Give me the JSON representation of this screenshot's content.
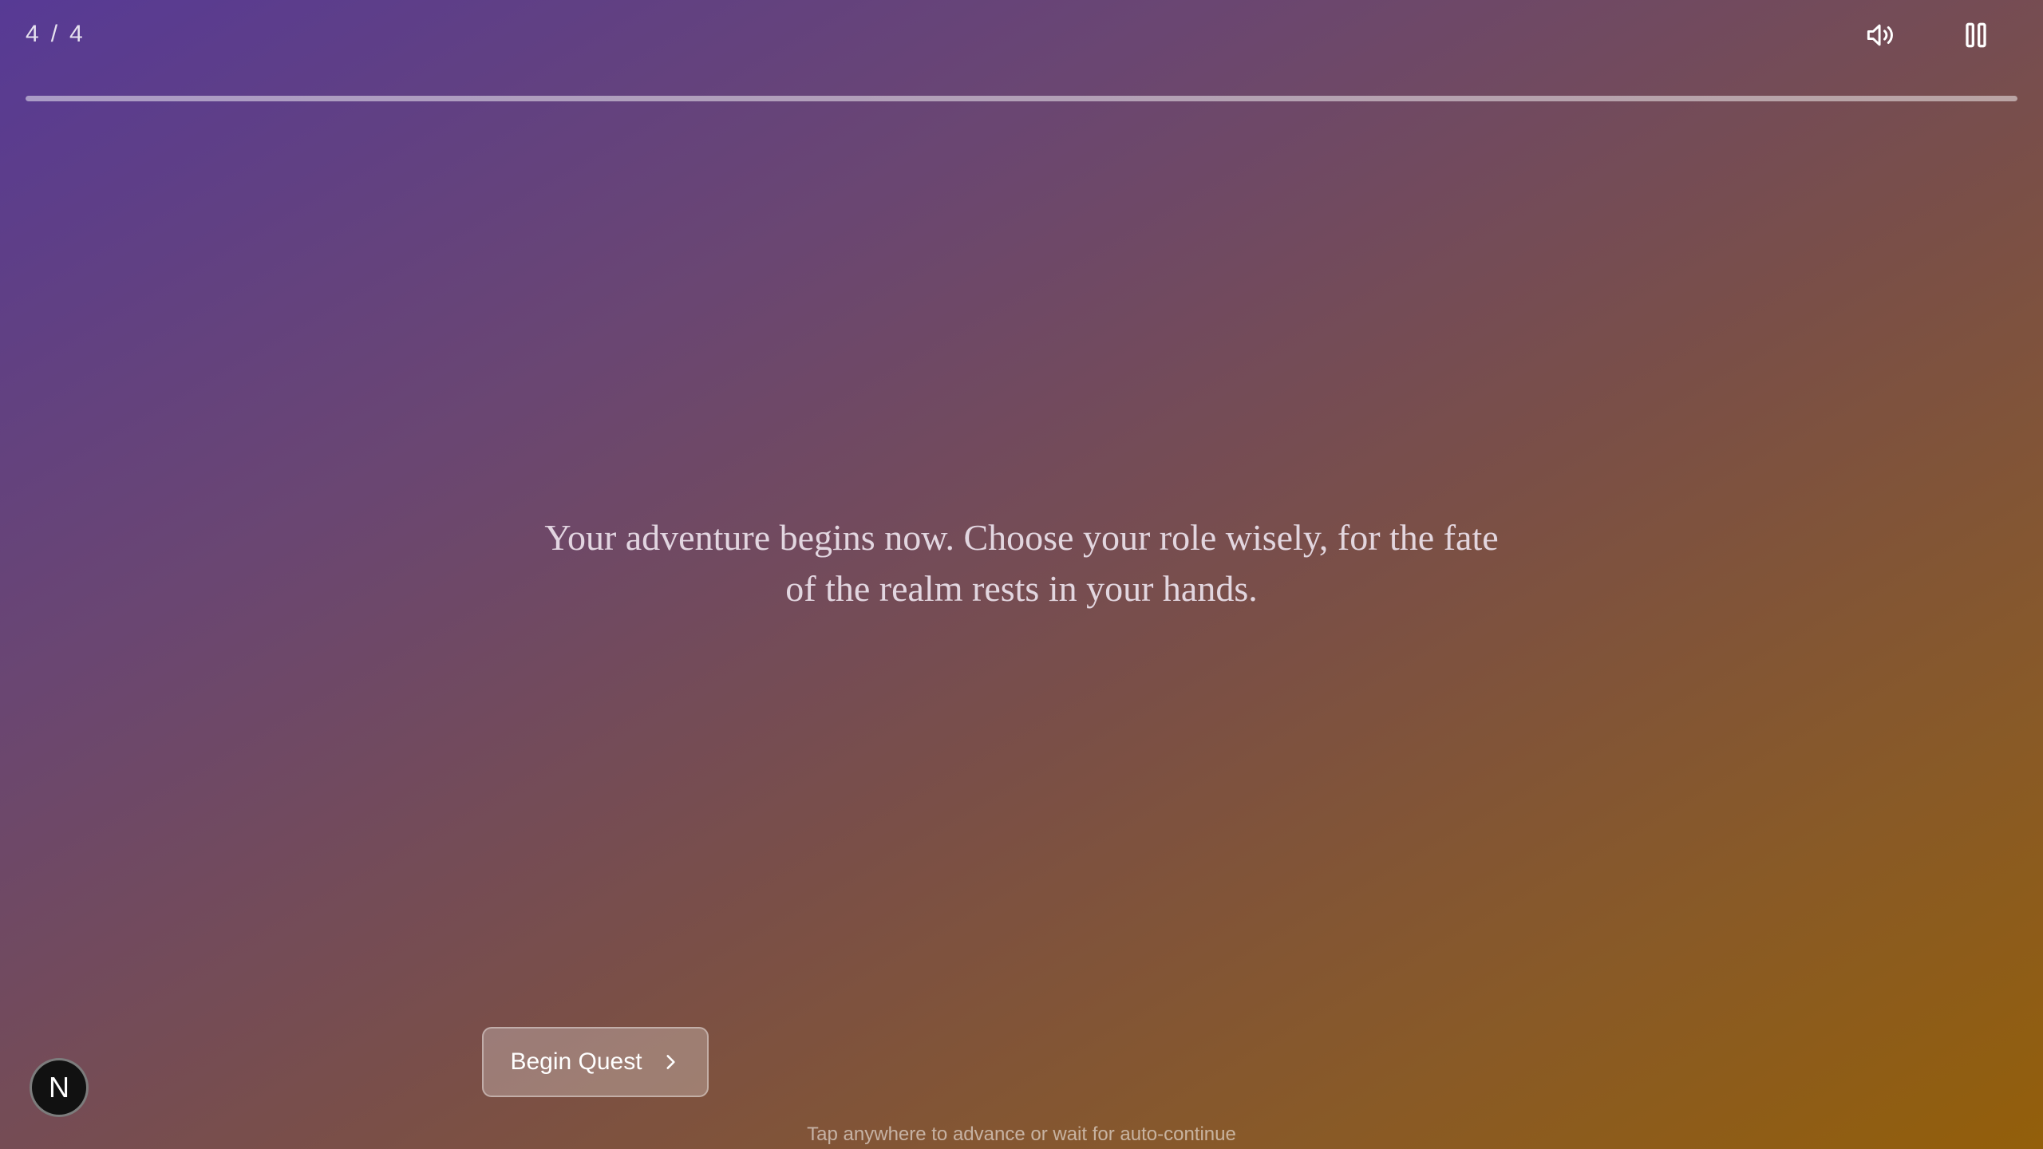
{
  "slide_counter": {
    "current": "4",
    "separator": "/",
    "total": "4"
  },
  "controls": {
    "sound_icon": "speaker-volume-icon",
    "pause_icon": "pause-icon"
  },
  "progress": {
    "fraction": 1.0
  },
  "narration": {
    "text": "Your adventure begins now. Choose your role wisely, for the fate of the realm rests in your hands."
  },
  "cta": {
    "label": "Begin Quest",
    "icon": "chevron-right-icon"
  },
  "hint": {
    "text": "Tap anywhere to advance or wait for auto-continue"
  },
  "badge": {
    "letter": "N"
  },
  "colors": {
    "gradient_start": "#573a95",
    "gradient_end": "#935f0a"
  }
}
